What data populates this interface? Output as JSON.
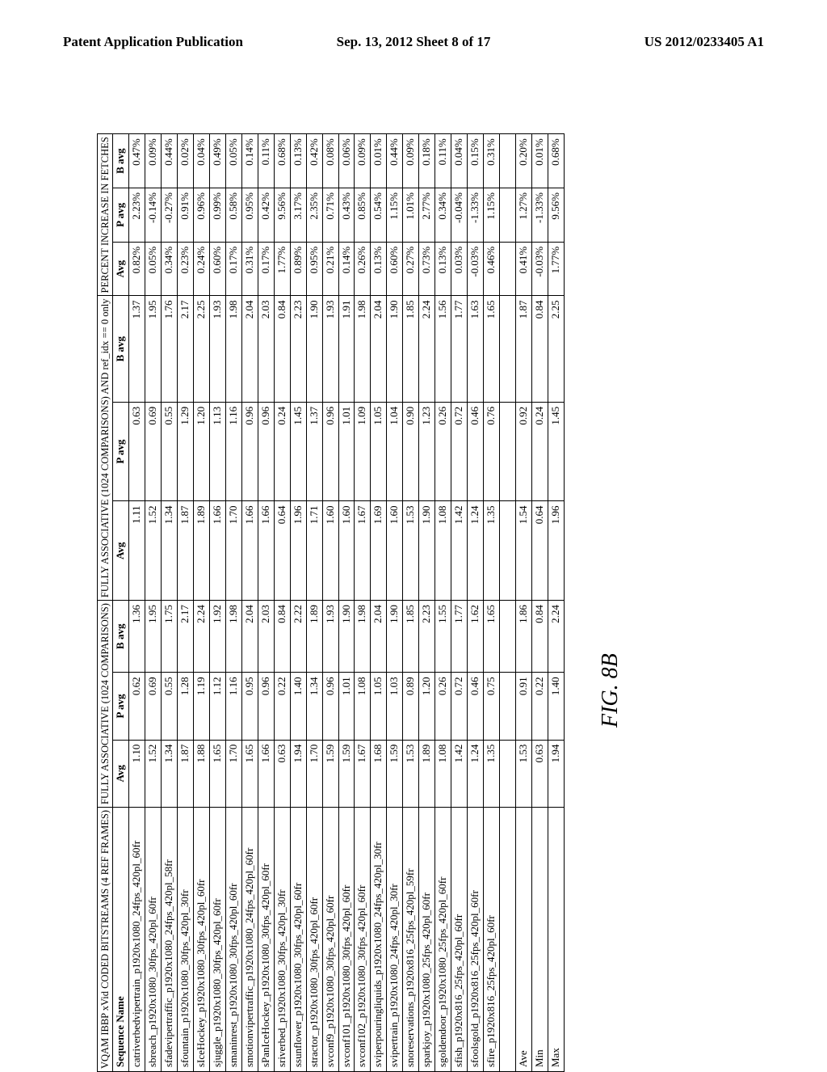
{
  "header": {
    "left": "Patent Application Publication",
    "center": "Sep. 13, 2012  Sheet 8 of 17",
    "right": "US 2012/0233405 A1"
  },
  "figure_label": "FIG. 8B",
  "table": {
    "group_headers": {
      "seq": "VQAM IBBP xVid CODED BITSTREAMS (4 REF FRAMES)",
      "fa": "FULLY ASSOCIATIVE (1024 COMPARISONS)",
      "fa2": "FULLY ASSOCIATIVE (1024 COMPARISONS) AND ref_idx == 0 only",
      "pi": "PERCENT INCREASE IN FETCHES"
    },
    "col_headers": [
      "Sequence Name",
      "Avg",
      "P avg",
      "B avg",
      "Avg",
      "P avg",
      "B avg",
      "Avg",
      "P avg",
      "B avg"
    ],
    "rows": [
      [
        "catriverbedvipertrain_p1920x1080_24fps_420pl_60fr",
        "1.10",
        "0.62",
        "1.36",
        "1.11",
        "0.63",
        "1.37",
        "0.82%",
        "2.23%",
        "0.47%"
      ],
      [
        "sbreach_p1920x1080_30fps_420pl_60fr",
        "1.52",
        "0.69",
        "1.95",
        "1.52",
        "0.69",
        "1.95",
        "0.05%",
        "-0.14%",
        "0.09%"
      ],
      [
        "sfadevipertraffic_p1920x1080_24fps_420pl_58fr",
        "1.34",
        "0.55",
        "1.75",
        "1.34",
        "0.55",
        "1.76",
        "0.34%",
        "-0.27%",
        "0.44%"
      ],
      [
        "sfountain_p1920x1080_30fps_420pl_30fr",
        "1.87",
        "1.28",
        "2.17",
        "1.87",
        "1.29",
        "2.17",
        "0.23%",
        "0.91%",
        "0.02%"
      ],
      [
        "sIceHockey_p1920x1080_30fps_420pl_60fr",
        "1.88",
        "1.19",
        "2.24",
        "1.89",
        "1.20",
        "2.25",
        "0.24%",
        "0.96%",
        "0.04%"
      ],
      [
        "sjuggle_p1920x1080_30fps_420pl_60fr",
        "1.65",
        "1.12",
        "1.92",
        "1.66",
        "1.13",
        "1.93",
        "0.60%",
        "0.99%",
        "0.49%"
      ],
      [
        "smaninrest_p1920x1080_30fps_420pl_60fr",
        "1.70",
        "1.16",
        "1.98",
        "1.70",
        "1.16",
        "1.98",
        "0.17%",
        "0.58%",
        "0.05%"
      ],
      [
        "smotionvipertraffic_p1920x1080_24fps_420pl_60fr",
        "1.65",
        "0.95",
        "2.04",
        "1.66",
        "0.96",
        "2.04",
        "0.31%",
        "0.95%",
        "0.14%"
      ],
      [
        "sPanIceHockey_p1920x1080_30fps_420pl_60fr",
        "1.66",
        "0.96",
        "2.03",
        "1.66",
        "0.96",
        "2.03",
        "0.17%",
        "0.42%",
        "0.11%"
      ],
      [
        "sriverbed_p1920x1080_30fps_420pl_30fr",
        "0.63",
        "0.22",
        "0.84",
        "0.64",
        "0.24",
        "0.84",
        "1.77%",
        "9.56%",
        "0.68%"
      ],
      [
        "ssunflower_p1920x1080_30fps_420pl_60fr",
        "1.94",
        "1.40",
        "2.22",
        "1.96",
        "1.45",
        "2.23",
        "0.89%",
        "3.17%",
        "0.13%"
      ],
      [
        "stractor_p1920x1080_30fps_420pl_60fr",
        "1.70",
        "1.34",
        "1.89",
        "1.71",
        "1.37",
        "1.90",
        "0.95%",
        "2.35%",
        "0.42%"
      ],
      [
        "svconf9_p1920x1080_30fps_420pl_60fr",
        "1.59",
        "0.96",
        "1.93",
        "1.60",
        "0.96",
        "1.93",
        "0.21%",
        "0.71%",
        "0.08%"
      ],
      [
        "svconf101_p1920x1080_30fps_420pl_60fr",
        "1.59",
        "1.01",
        "1.90",
        "1.60",
        "1.01",
        "1.91",
        "0.14%",
        "0.43%",
        "0.06%"
      ],
      [
        "svconf102_p1920x1080_30fps_420pl_60fr",
        "1.67",
        "1.08",
        "1.98",
        "1.67",
        "1.09",
        "1.98",
        "0.26%",
        "0.85%",
        "0.09%"
      ],
      [
        "sviperpouringliquids_p1920x1080_24fps_420pl_30fr",
        "1.68",
        "1.05",
        "2.04",
        "1.69",
        "1.05",
        "2.04",
        "0.13%",
        "0.54%",
        "0.01%"
      ],
      [
        "svipertrain_p1920x1080_24fps_420pl_30fr",
        "1.59",
        "1.03",
        "1.90",
        "1.60",
        "1.04",
        "1.90",
        "0.60%",
        "1.15%",
        "0.44%"
      ],
      [
        "snoreservations_p1920x816_25fps_420pl_59fr",
        "1.53",
        "0.89",
        "1.85",
        "1.53",
        "0.90",
        "1.85",
        "0.27%",
        "1.01%",
        "0.09%"
      ],
      [
        "sparkjoy_p1920x1080_25fps_420pl_60fr",
        "1.89",
        "1.20",
        "2.23",
        "1.90",
        "1.23",
        "2.24",
        "0.73%",
        "2.77%",
        "0.18%"
      ],
      [
        "sgoldendoor_p1920x1080_25fps_420pl_60fr",
        "1.08",
        "0.26",
        "1.55",
        "1.08",
        "0.26",
        "1.56",
        "0.13%",
        "0.34%",
        "0.11%"
      ],
      [
        "sfish_p1920x816_25fps_420pl_60fr",
        "1.42",
        "0.72",
        "1.77",
        "1.42",
        "0.72",
        "1.77",
        "0.03%",
        "-0.04%",
        "0.04%"
      ],
      [
        "sfoolsgold_p1920x816_25fps_420pl_60fr",
        "1.24",
        "0.46",
        "1.62",
        "1.24",
        "0.46",
        "1.63",
        "-0.03%",
        "-1.33%",
        "0.15%"
      ],
      [
        "sfire_p1920x816_25fps_420pl_60fr",
        "1.35",
        "0.75",
        "1.65",
        "1.35",
        "0.76",
        "1.65",
        "0.46%",
        "1.15%",
        "0.31%"
      ]
    ],
    "summary": [
      [
        "Ave",
        "1.53",
        "0.91",
        "1.86",
        "1.54",
        "0.92",
        "1.87",
        "0.41%",
        "1.27%",
        "0.20%"
      ],
      [
        "Min",
        "0.63",
        "0.22",
        "0.84",
        "0.64",
        "0.24",
        "0.84",
        "-0.03%",
        "-1.33%",
        "0.01%"
      ],
      [
        "Max",
        "1.94",
        "1.40",
        "2.24",
        "1.96",
        "1.45",
        "2.25",
        "1.77%",
        "9.56%",
        "0.68%"
      ]
    ]
  },
  "chart_data": {
    "type": "table",
    "title": "FIG. 8B – VQAM IBBP xVid coded bitstreams (4 ref frames): fully-associative cache comparisons and percent increase in fetches",
    "columns": [
      "Sequence Name",
      "FA Avg",
      "FA P avg",
      "FA B avg",
      "FA(ref_idx==0) Avg",
      "FA(ref_idx==0) P avg",
      "FA(ref_idx==0) B avg",
      "%Inc Avg",
      "%Inc P avg",
      "%Inc B avg"
    ],
    "rows": [
      [
        "catriverbedvipertrain_p1920x1080_24fps_420pl_60fr",
        1.1,
        0.62,
        1.36,
        1.11,
        0.63,
        1.37,
        0.82,
        2.23,
        0.47
      ],
      [
        "sbreach_p1920x1080_30fps_420pl_60fr",
        1.52,
        0.69,
        1.95,
        1.52,
        0.69,
        1.95,
        0.05,
        -0.14,
        0.09
      ],
      [
        "sfadevipertraffic_p1920x1080_24fps_420pl_58fr",
        1.34,
        0.55,
        1.75,
        1.34,
        0.55,
        1.76,
        0.34,
        -0.27,
        0.44
      ],
      [
        "sfountain_p1920x1080_30fps_420pl_30fr",
        1.87,
        1.28,
        2.17,
        1.87,
        1.29,
        2.17,
        0.23,
        0.91,
        0.02
      ],
      [
        "sIceHockey_p1920x1080_30fps_420pl_60fr",
        1.88,
        1.19,
        2.24,
        1.89,
        1.2,
        2.25,
        0.24,
        0.96,
        0.04
      ],
      [
        "sjuggle_p1920x1080_30fps_420pl_60fr",
        1.65,
        1.12,
        1.92,
        1.66,
        1.13,
        1.93,
        0.6,
        0.99,
        0.49
      ],
      [
        "smaninrest_p1920x1080_30fps_420pl_60fr",
        1.7,
        1.16,
        1.98,
        1.7,
        1.16,
        1.98,
        0.17,
        0.58,
        0.05
      ],
      [
        "smotionvipertraffic_p1920x1080_24fps_420pl_60fr",
        1.65,
        0.95,
        2.04,
        1.66,
        0.96,
        2.04,
        0.31,
        0.95,
        0.14
      ],
      [
        "sPanIceHockey_p1920x1080_30fps_420pl_60fr",
        1.66,
        0.96,
        2.03,
        1.66,
        0.96,
        2.03,
        0.17,
        0.42,
        0.11
      ],
      [
        "sriverbed_p1920x1080_30fps_420pl_30fr",
        0.63,
        0.22,
        0.84,
        0.64,
        0.24,
        0.84,
        1.77,
        9.56,
        0.68
      ],
      [
        "ssunflower_p1920x1080_30fps_420pl_60fr",
        1.94,
        1.4,
        2.22,
        1.96,
        1.45,
        2.23,
        0.89,
        3.17,
        0.13
      ],
      [
        "stractor_p1920x1080_30fps_420pl_60fr",
        1.7,
        1.34,
        1.89,
        1.71,
        1.37,
        1.9,
        0.95,
        2.35,
        0.42
      ],
      [
        "svconf9_p1920x1080_30fps_420pl_60fr",
        1.59,
        0.96,
        1.93,
        1.6,
        0.96,
        1.93,
        0.21,
        0.71,
        0.08
      ],
      [
        "svconf101_p1920x1080_30fps_420pl_60fr",
        1.59,
        1.01,
        1.9,
        1.6,
        1.01,
        1.91,
        0.14,
        0.43,
        0.06
      ],
      [
        "svconf102_p1920x1080_30fps_420pl_60fr",
        1.67,
        1.08,
        1.98,
        1.67,
        1.09,
        1.98,
        0.26,
        0.85,
        0.09
      ],
      [
        "sviperpouringliquids_p1920x1080_24fps_420pl_30fr",
        1.68,
        1.05,
        2.04,
        1.69,
        1.05,
        2.04,
        0.13,
        0.54,
        0.01
      ],
      [
        "svipertrain_p1920x1080_24fps_420pl_30fr",
        1.59,
        1.03,
        1.9,
        1.6,
        1.04,
        1.9,
        0.6,
        1.15,
        0.44
      ],
      [
        "snoreservations_p1920x816_25fps_420pl_59fr",
        1.53,
        0.89,
        1.85,
        1.53,
        0.9,
        1.85,
        0.27,
        1.01,
        0.09
      ],
      [
        "sparkjoy_p1920x1080_25fps_420pl_60fr",
        1.89,
        1.2,
        2.23,
        1.9,
        1.23,
        2.24,
        0.73,
        2.77,
        0.18
      ],
      [
        "sgoldendoor_p1920x1080_25fps_420pl_60fr",
        1.08,
        0.26,
        1.55,
        1.08,
        0.26,
        1.56,
        0.13,
        0.34,
        0.11
      ],
      [
        "sfish_p1920x816_25fps_420pl_60fr",
        1.42,
        0.72,
        1.77,
        1.42,
        0.72,
        1.77,
        0.03,
        -0.04,
        0.04
      ],
      [
        "sfoolsgold_p1920x816_25fps_420pl_60fr",
        1.24,
        0.46,
        1.62,
        1.24,
        0.46,
        1.63,
        -0.03,
        -1.33,
        0.15
      ],
      [
        "sfire_p1920x816_25fps_420pl_60fr",
        1.35,
        0.75,
        1.65,
        1.35,
        0.76,
        1.65,
        0.46,
        1.15,
        0.31
      ]
    ],
    "summary": {
      "Ave": [
        1.53,
        0.91,
        1.86,
        1.54,
        0.92,
        1.87,
        0.41,
        1.27,
        0.2
      ],
      "Min": [
        0.63,
        0.22,
        0.84,
        0.64,
        0.24,
        0.84,
        -0.03,
        -1.33,
        0.01
      ],
      "Max": [
        1.94,
        1.4,
        2.24,
        1.96,
        1.45,
        2.25,
        1.77,
        9.56,
        0.68
      ]
    }
  }
}
